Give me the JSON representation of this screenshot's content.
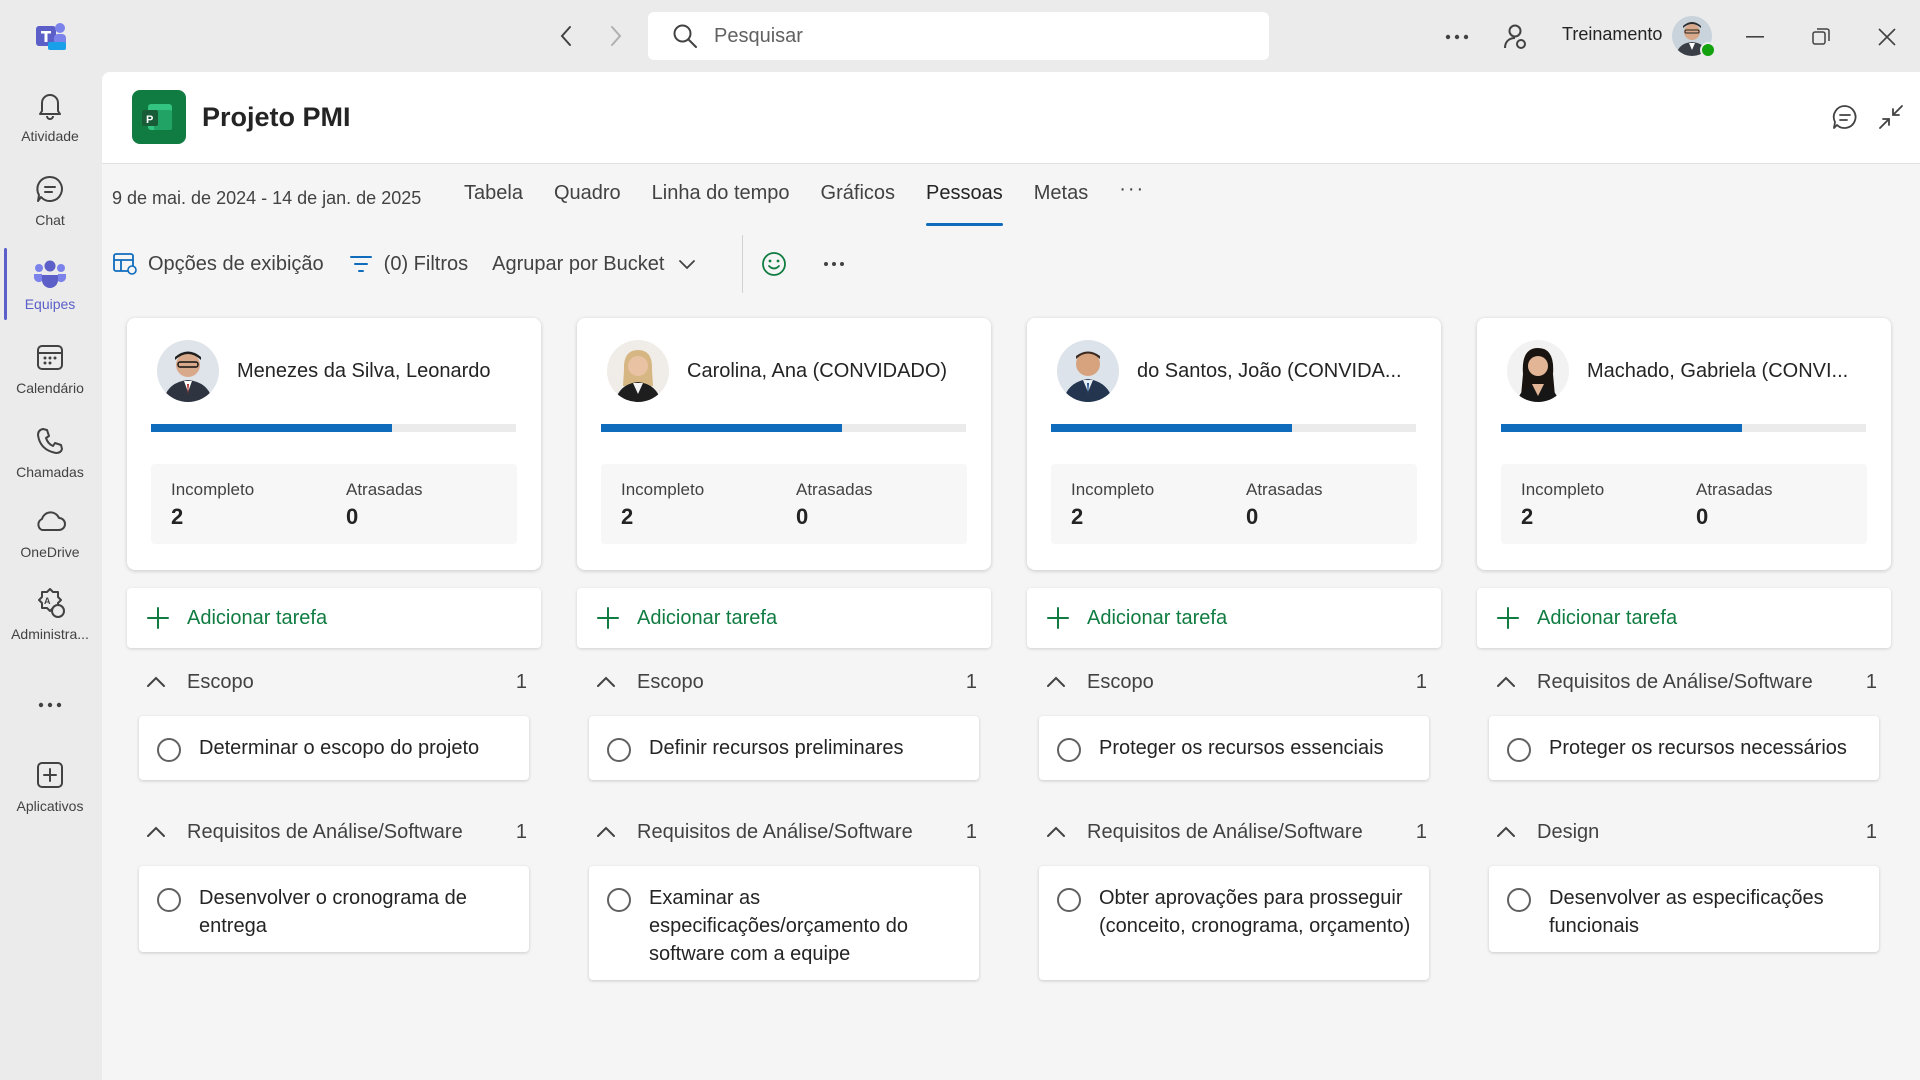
{
  "search": {
    "placeholder": "Pesquisar"
  },
  "account": {
    "name": "Treinamento"
  },
  "rail": {
    "items": [
      {
        "label": "Atividade"
      },
      {
        "label": "Chat"
      },
      {
        "label": "Equipes"
      },
      {
        "label": "Calendário"
      },
      {
        "label": "Chamadas"
      },
      {
        "label": "OneDrive"
      },
      {
        "label": "Administra..."
      },
      {
        "label": "Aplicativos"
      }
    ],
    "active": "Equipes"
  },
  "header": {
    "title": "Projeto PMI"
  },
  "date_range": "9 de mai. de 2024 - 14 de jan. de 2025",
  "tabs": [
    {
      "label": "Tabela"
    },
    {
      "label": "Quadro"
    },
    {
      "label": "Linha do tempo"
    },
    {
      "label": "Gráficos"
    },
    {
      "label": "Pessoas"
    },
    {
      "label": "Metas"
    }
  ],
  "active_tab": "Pessoas",
  "tab_more": "···",
  "toolbar": {
    "view_options": "Opções de exibição",
    "filters": "(0) Filtros",
    "group_by": "Agrupar por Bucket"
  },
  "add_task_label": "Adicionar tarefa",
  "people": [
    {
      "name": "Menezes da Silva, Leonardo",
      "progress": 0.66,
      "incomplete_label": "Incompleto",
      "incomplete": "2",
      "late_label": "Atrasadas",
      "late": "0",
      "groups": [
        {
          "name": "Escopo",
          "count": "1",
          "tasks": [
            "Determinar o escopo do projeto"
          ]
        },
        {
          "name": "Requisitos de Análise/Software",
          "count": "1",
          "tasks": [
            "Desenvolver o cronograma de entrega"
          ]
        }
      ]
    },
    {
      "name": "Carolina, Ana (CONVIDADO)",
      "progress": 0.66,
      "incomplete_label": "Incompleto",
      "incomplete": "2",
      "late_label": "Atrasadas",
      "late": "0",
      "groups": [
        {
          "name": "Escopo",
          "count": "1",
          "tasks": [
            "Definir recursos preliminares"
          ]
        },
        {
          "name": "Requisitos de Análise/Software",
          "count": "1",
          "tasks": [
            "Examinar as especificações/orçamento do software com a equipe"
          ]
        }
      ]
    },
    {
      "name": "do Santos, João (CONVIDA...",
      "progress": 0.66,
      "incomplete_label": "Incompleto",
      "incomplete": "2",
      "late_label": "Atrasadas",
      "late": "0",
      "groups": [
        {
          "name": "Escopo",
          "count": "1",
          "tasks": [
            "Proteger os recursos essenciais"
          ]
        },
        {
          "name": "Requisitos de Análise/Software",
          "count": "1",
          "tasks": [
            "Obter aprovações para prosseguir (conceito, cronograma, orçamento)"
          ]
        }
      ]
    },
    {
      "name": "Machado, Gabriela (CONVI...",
      "progress": 0.66,
      "incomplete_label": "Incompleto",
      "incomplete": "2",
      "late_label": "Atrasadas",
      "late": "0",
      "groups": [
        {
          "name": "Requisitos de Análise/Software",
          "count": "1",
          "tasks": [
            "Proteger os recursos necessários"
          ]
        },
        {
          "name": "Design",
          "count": "1",
          "tasks": [
            "Desenvolver as especificações funcionais"
          ]
        }
      ]
    }
  ],
  "colors": {
    "accent": "#0f6cbd",
    "teams": "#5b5fc7",
    "planner": "#107c41",
    "add_task": "#107c41"
  }
}
